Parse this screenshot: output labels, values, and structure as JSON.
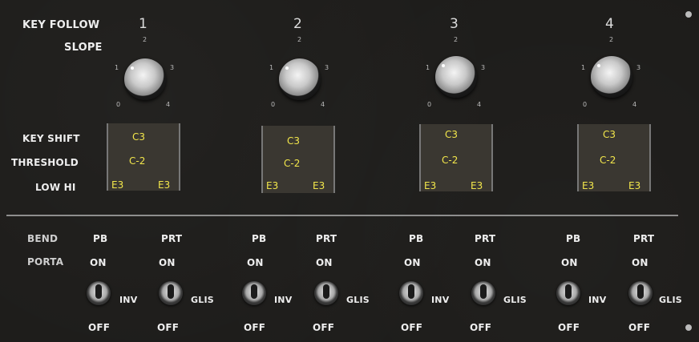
{
  "labels": {
    "key_follow": "KEY FOLLOW",
    "slope": "SLOPE",
    "key_shift": "KEY SHIFT",
    "threshold": "THRESHOLD",
    "low_hi": "LOW HI",
    "bend": "BEND",
    "porta": "PORTA"
  },
  "knob_scale": [
    "0",
    "1",
    "2",
    "3",
    "4"
  ],
  "channels": [
    {
      "number": "1",
      "key_shift": "C3",
      "threshold": "C-2",
      "low": "E3",
      "hi": "E3",
      "bend_label": "PB",
      "porta_label": "PRT",
      "bend_on": "ON",
      "bend_off": "OFF",
      "bend_side": "INV",
      "porta_on": "ON",
      "porta_off": "OFF",
      "porta_side": "GLIS"
    },
    {
      "number": "2",
      "key_shift": "C3",
      "threshold": "C-2",
      "low": "E3",
      "hi": "E3",
      "bend_label": "PB",
      "porta_label": "PRT",
      "bend_on": "ON",
      "bend_off": "OFF",
      "bend_side": "INV",
      "porta_on": "ON",
      "porta_off": "OFF",
      "porta_side": "GLIS"
    },
    {
      "number": "3",
      "key_shift": "C3",
      "threshold": "C-2",
      "low": "E3",
      "hi": "E3",
      "bend_label": "PB",
      "porta_label": "PRT",
      "bend_on": "ON",
      "bend_off": "OFF",
      "bend_side": "INV",
      "porta_on": "ON",
      "porta_off": "OFF",
      "porta_side": "GLIS"
    },
    {
      "number": "4",
      "key_shift": "C3",
      "threshold": "C-2",
      "low": "E3",
      "hi": "E3",
      "bend_label": "PB",
      "porta_label": "PRT",
      "bend_on": "ON",
      "bend_off": "OFF",
      "bend_side": "INV",
      "porta_on": "ON",
      "porta_off": "OFF",
      "porta_side": "GLIS"
    }
  ],
  "colors": {
    "panel": "#1c1b19",
    "display_text": "#f2e64b",
    "label": "#eeeeee"
  }
}
